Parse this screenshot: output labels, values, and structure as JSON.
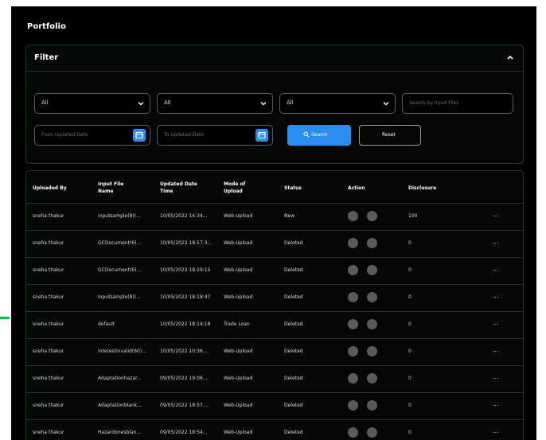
{
  "page": {
    "title": "Portfolio"
  },
  "filter": {
    "title": "Filter",
    "select1": "All",
    "select2": "All",
    "select3": "All",
    "search_placeholder": "Search by Input Files",
    "from_date_placeholder": "From Updated Date",
    "to_date_placeholder": "To Updated Date",
    "search_button": "Search",
    "reset_button": "Reset"
  },
  "table": {
    "headers": {
      "uploaded_by": "Uploaded By",
      "input_file": "Input File Name",
      "updated_date": "Updated Date Time",
      "mode": "Mode of Upload",
      "status": "Status",
      "action": "Action",
      "disclosure": "Disclosure"
    },
    "rows": [
      {
        "uploaded_by": "sneha thakur",
        "input_file": "inputsample(8)(...",
        "updated_date": "10/05/2022 14:34...",
        "mode": "Web-Upload",
        "status": "New",
        "disclosure": "100",
        "more": "..."
      },
      {
        "uploaded_by": "sneha thakur",
        "input_file": "GCDocument(6)...",
        "updated_date": "10/05/2022 18:57:3...",
        "mode": "Web-Upload",
        "status": "Deleted",
        "disclosure": "0",
        "more": "..."
      },
      {
        "uploaded_by": "sneha thakur",
        "input_file": "GCDocument(6)...",
        "updated_date": "10/05/2022 18:29:15",
        "mode": "Web-Upload",
        "status": "Deleted",
        "disclosure": "0",
        "more": "..."
      },
      {
        "uploaded_by": "sneha thakur",
        "input_file": "inputsample(8)(...",
        "updated_date": "10/05/2022 18:18:47",
        "mode": "Web-Upload",
        "status": "Deleted",
        "disclosure": "0",
        "more": "..."
      },
      {
        "uploaded_by": "sneha thakur",
        "input_file": "default",
        "updated_date": "10/05/2022 18:14:18",
        "mode": "Trade Loan",
        "status": "Deleted",
        "disclosure": "0",
        "more": "..."
      },
      {
        "uploaded_by": "sneha thakur",
        "input_file": "interestinvalid(60)...",
        "updated_date": "10/05/2022 10:36...",
        "mode": "Web-Upload",
        "status": "Deleted",
        "disclosure": "0",
        "more": "..."
      },
      {
        "uploaded_by": "sneha thakur",
        "input_file": "Adaptationhazar...",
        "updated_date": "09/05/2022 19:06...",
        "mode": "Web-Upload",
        "status": "Deleted",
        "disclosure": "0",
        "more": "..."
      },
      {
        "uploaded_by": "sneha thakur",
        "input_file": "Adaptationblank...",
        "updated_date": "09/05/2022 18:57...",
        "mode": "Web-Upload",
        "status": "Deleted",
        "disclosure": "0",
        "more": "..."
      },
      {
        "uploaded_by": "sneha thakur",
        "input_file": "Hazardonesblan...",
        "updated_date": "09/05/2022 18:54...",
        "mode": "Web-Upload",
        "status": "Deleted",
        "disclosure": "0",
        "more": "..."
      }
    ]
  },
  "colors": {
    "accent": "#2a8ef0",
    "panel_border": "#1f3a22",
    "background": "#000000"
  }
}
